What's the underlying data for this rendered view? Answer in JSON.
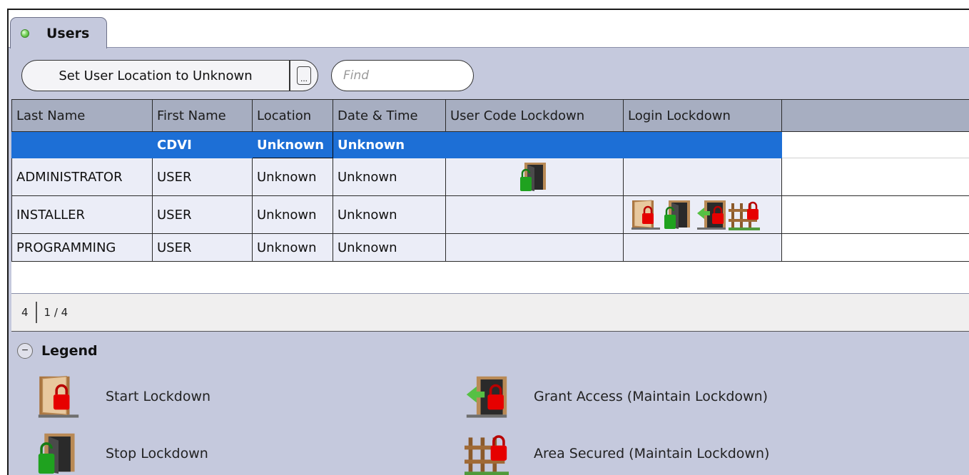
{
  "tab": {
    "label": "Users"
  },
  "toolbar": {
    "set_location_label": "Set User Location to Unknown",
    "more_label": "...",
    "find_placeholder": "Find"
  },
  "table": {
    "columns": [
      "Last Name",
      "First Name",
      "Location",
      "Date & Time",
      "User Code Lockdown",
      "Login Lockdown"
    ],
    "rows": [
      {
        "last_name": "",
        "first_name": "CDVI",
        "location": "Unknown",
        "date_time": "Unknown",
        "user_code_lockdown": [],
        "login_lockdown": [],
        "selected": true
      },
      {
        "last_name": "ADMINISTRATOR",
        "first_name": "USER",
        "location": "Unknown",
        "date_time": "Unknown",
        "user_code_lockdown": [
          "stop-lockdown-icon"
        ],
        "login_lockdown": []
      },
      {
        "last_name": "INSTALLER",
        "first_name": "USER",
        "location": "Unknown",
        "date_time": "Unknown",
        "user_code_lockdown": [],
        "login_lockdown": [
          "start-lockdown-icon",
          "stop-lockdown-icon",
          "grant-access-icon",
          "area-secured-icon"
        ]
      },
      {
        "last_name": "PROGRAMMING",
        "first_name": "USER",
        "location": "Unknown",
        "date_time": "Unknown",
        "user_code_lockdown": [],
        "login_lockdown": []
      }
    ]
  },
  "pager": {
    "total": "4",
    "page": "1 / 4"
  },
  "legend": {
    "title": "Legend",
    "items": [
      {
        "icon": "start-lockdown-icon",
        "label": "Start Lockdown"
      },
      {
        "icon": "stop-lockdown-icon",
        "label": "Stop Lockdown"
      },
      {
        "icon": "grant-access-icon",
        "label": "Grant Access (Maintain Lockdown)"
      },
      {
        "icon": "area-secured-icon",
        "label": "Area Secured (Maintain Lockdown)"
      }
    ]
  },
  "colors": {
    "panel": "#c5c9dd",
    "header": "#a7aec1",
    "selection": "#1d6fd6",
    "status_led": "#5cc43a"
  }
}
